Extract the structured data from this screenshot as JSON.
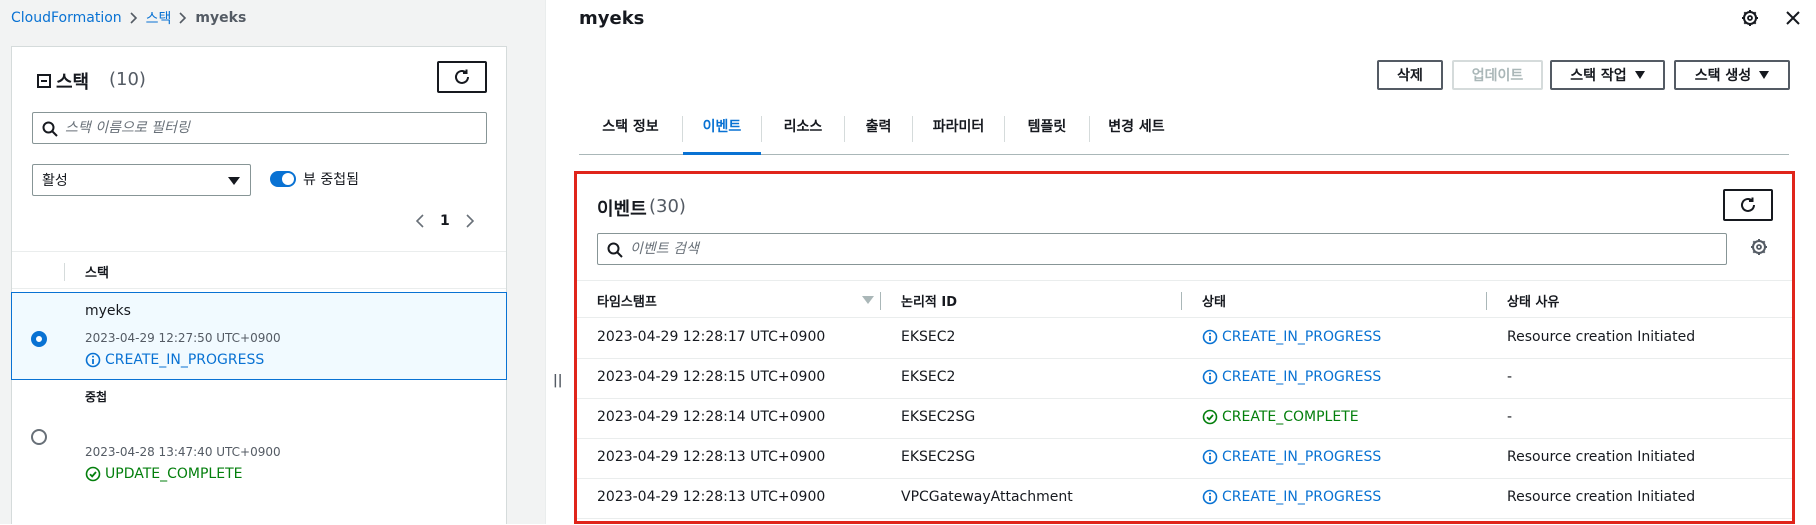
{
  "breadcrumb": {
    "root": "CloudFormation",
    "stacks": "스택",
    "current": "myeks"
  },
  "stack_panel": {
    "title": "스택",
    "count": "(10)",
    "search_placeholder": "스택 이름으로 필터링",
    "status_filter": "활성",
    "nested_toggle_label": "뷰 중첩됨",
    "nested_toggle_on": true,
    "page": "1",
    "column_header": "스택",
    "rows": [
      {
        "name": "myeks",
        "date": "2023-04-29 12:27:50 UTC+0900",
        "status": "CREATE_IN_PROGRESS",
        "selected": true
      },
      {
        "name": "중첩",
        "date": "2023-04-28 13:47:40 UTC+0900",
        "status": "UPDATE_COMPLETE",
        "selected": false
      }
    ]
  },
  "detail": {
    "title": "myeks",
    "buttons": {
      "delete": "삭제",
      "update": "업데이트",
      "stack_actions": "스택 작업",
      "create_stack": "스택 생성"
    },
    "tabs": [
      "스택 정보",
      "이벤트",
      "리소스",
      "출력",
      "파라미터",
      "템플릿",
      "변경 세트"
    ],
    "active_tab": "이벤트"
  },
  "events": {
    "title": "이벤트",
    "count": "(30)",
    "search_placeholder": "이벤트 검색",
    "columns": [
      "타임스탬프",
      "논리적 ID",
      "상태",
      "상태 사유"
    ],
    "rows": [
      {
        "timestamp": "2023-04-29 12:28:17 UTC+0900",
        "logical_id": "EKSEC2",
        "status": "CREATE_IN_PROGRESS",
        "reason": "Resource creation Initiated"
      },
      {
        "timestamp": "2023-04-29 12:28:15 UTC+0900",
        "logical_id": "EKSEC2",
        "status": "CREATE_IN_PROGRESS",
        "reason": "-"
      },
      {
        "timestamp": "2023-04-29 12:28:14 UTC+0900",
        "logical_id": "EKSEC2SG",
        "status": "CREATE_COMPLETE",
        "reason": "-"
      },
      {
        "timestamp": "2023-04-29 12:28:13 UTC+0900",
        "logical_id": "EKSEC2SG",
        "status": "CREATE_IN_PROGRESS",
        "reason": "Resource creation Initiated"
      },
      {
        "timestamp": "2023-04-29 12:28:13 UTC+0900",
        "logical_id": "VPCGatewayAttachment",
        "status": "CREATE_IN_PROGRESS",
        "reason": "Resource creation Initiated"
      }
    ]
  },
  "colors": {
    "link": "#0972d3",
    "success": "#037f0c",
    "highlight_border": "#e0251b"
  }
}
